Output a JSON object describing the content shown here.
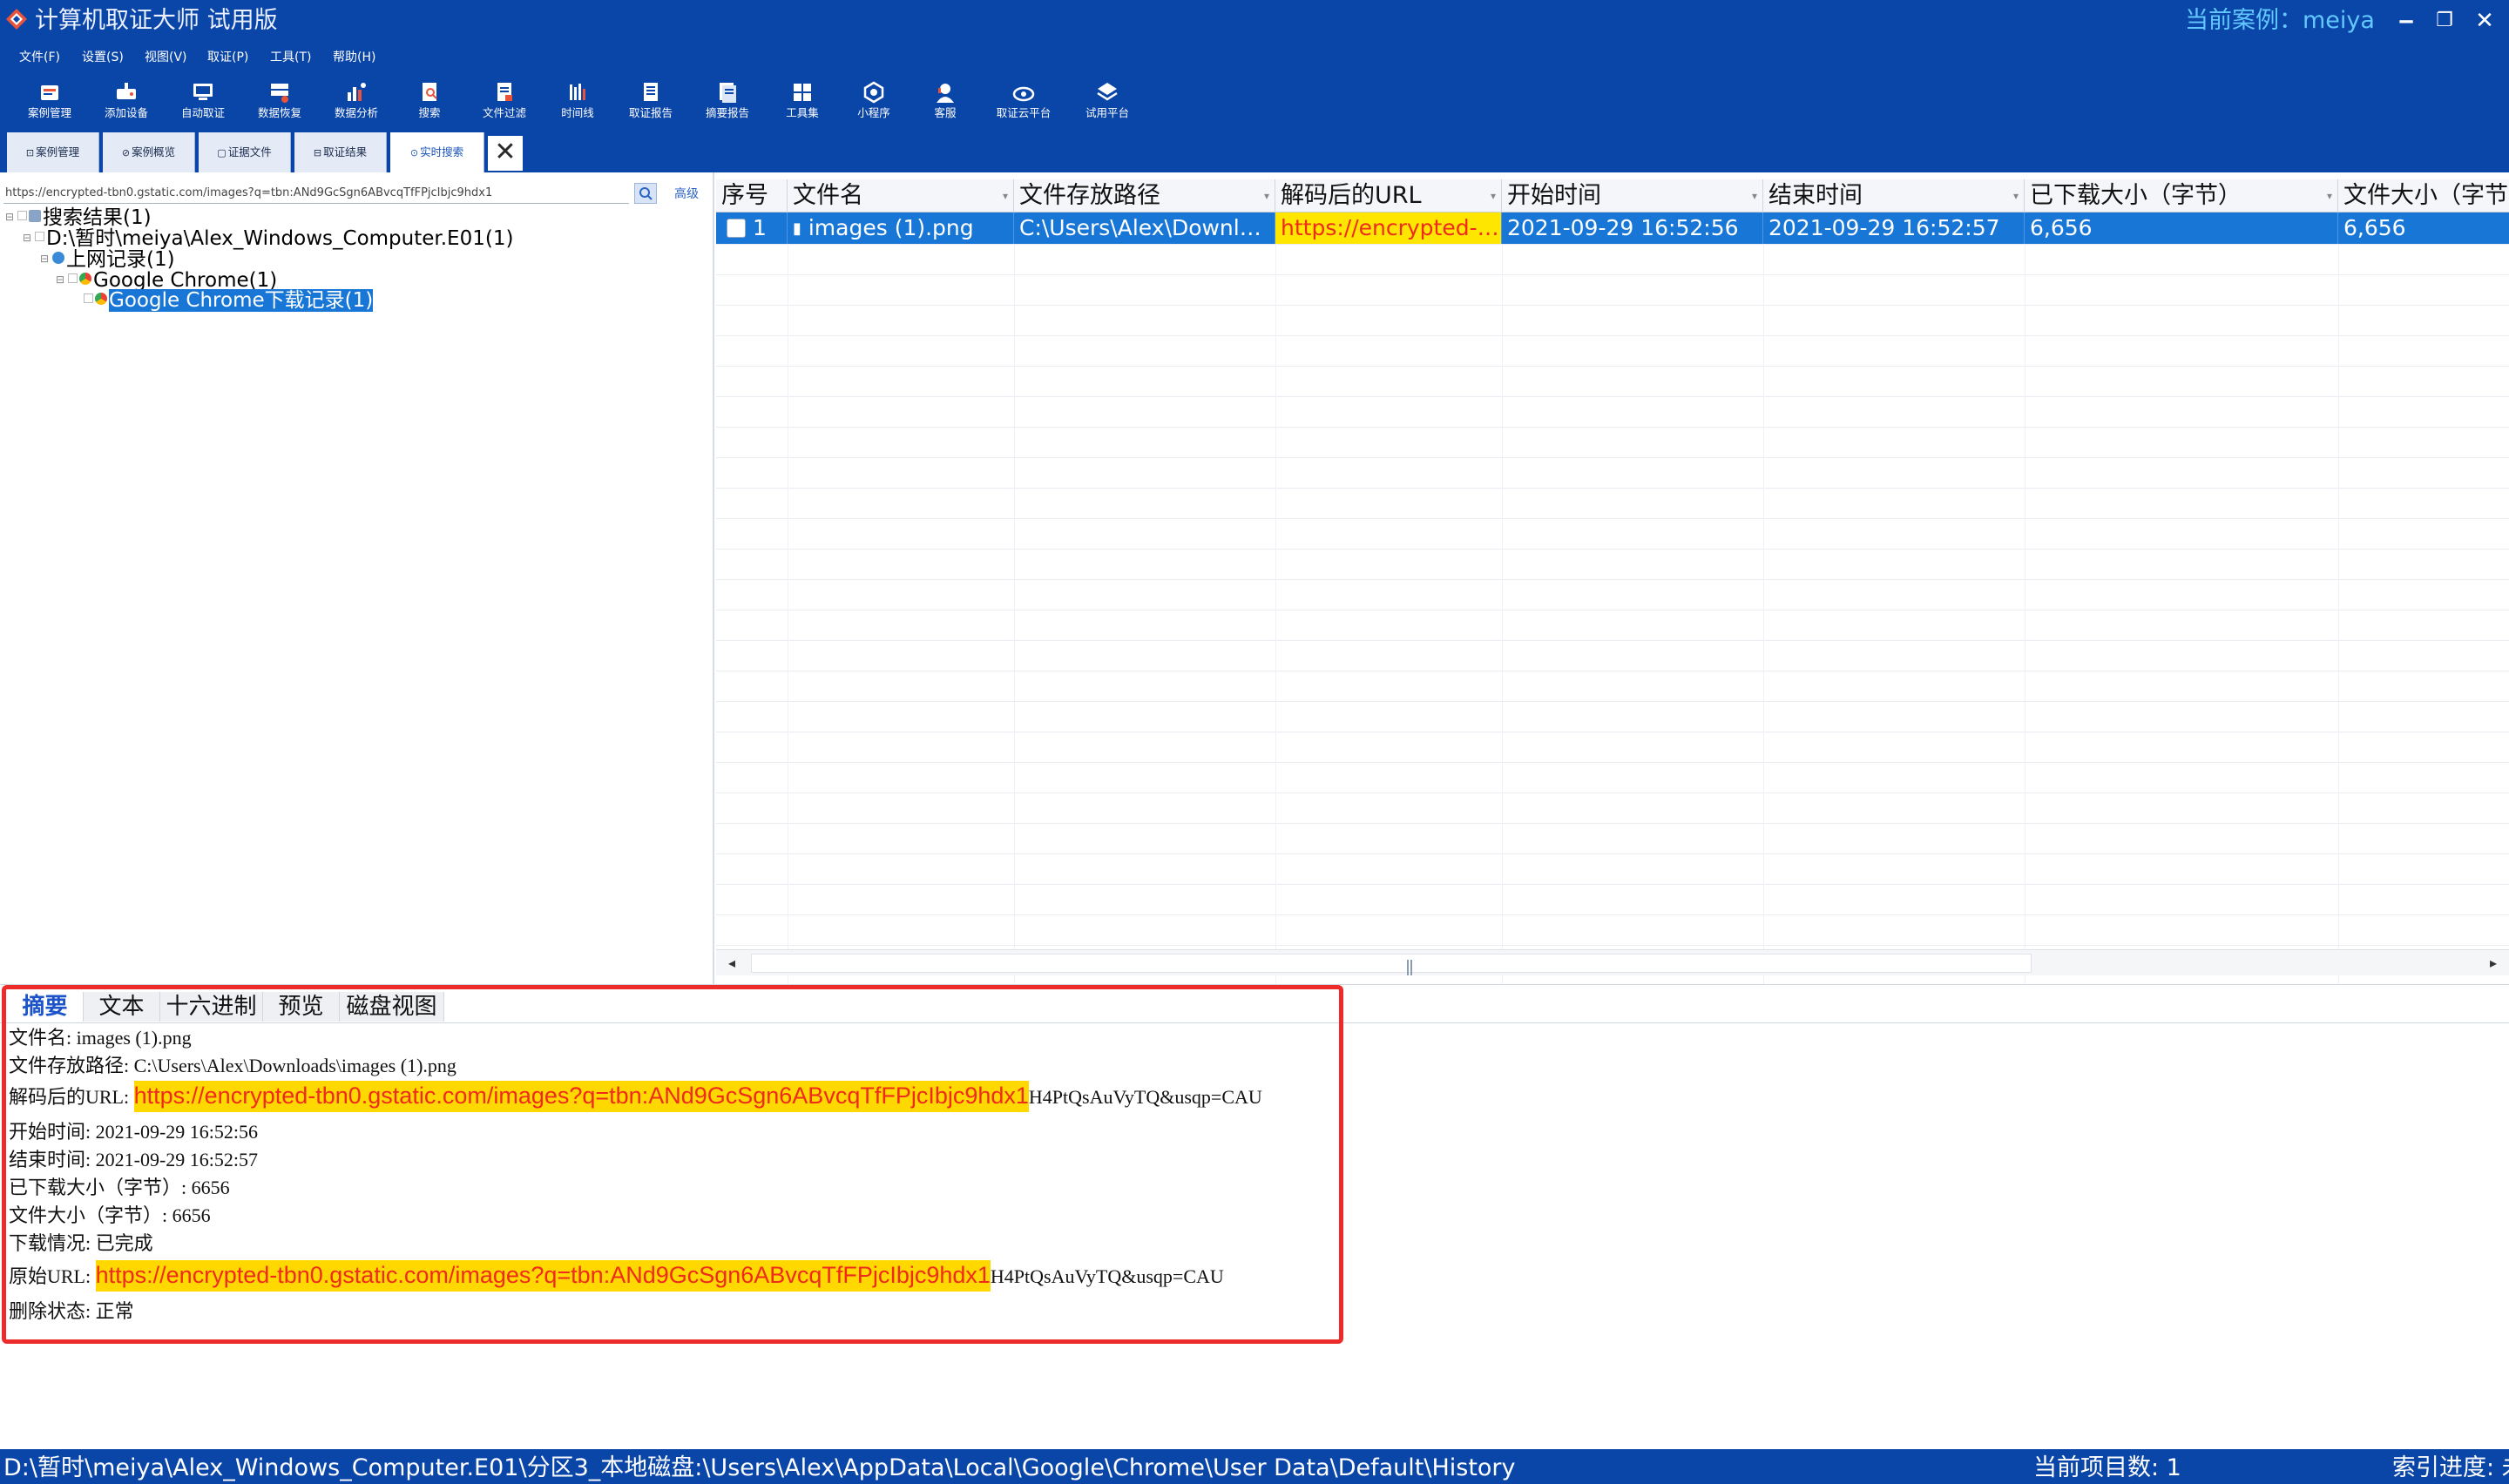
{
  "window": {
    "title": "计算机取证大师 试用版",
    "current_case": "当前案例：meiya",
    "minimize_glyph": "‒",
    "restore_glyph": "❐",
    "close_glyph": "✕"
  },
  "colors": {
    "chrome_blue": "#0a45a8",
    "selection_blue": "#1877d6",
    "highlight_yellow": "#ffd800",
    "link_red": "#ee2b1c",
    "annotation_red": "#ee2b2b"
  },
  "menu": [
    "文件(F)",
    "设置(S)",
    "视图(V)",
    "取证(P)",
    "工具(T)",
    "帮助(H)"
  ],
  "toolbar": [
    {
      "label": "案例管理",
      "icon": "case-manage-icon"
    },
    {
      "label": "添加设备",
      "icon": "add-device-icon"
    },
    {
      "label": "自动取证",
      "icon": "auto-forensics-icon"
    },
    {
      "label": "数据恢复",
      "icon": "data-recovery-icon"
    },
    {
      "label": "数据分析",
      "icon": "data-analysis-icon"
    },
    {
      "label": "搜索",
      "icon": "search-icon"
    },
    {
      "label": "文件过滤",
      "icon": "file-filter-icon"
    },
    {
      "label": "时间线",
      "icon": "timeline-icon"
    },
    {
      "label": "取证报告",
      "icon": "forensic-report-icon"
    },
    {
      "label": "摘要报告",
      "icon": "summary-report-icon"
    },
    {
      "label": "工具集",
      "icon": "toolset-icon"
    },
    {
      "label": "小程序",
      "icon": "mini-program-icon"
    },
    {
      "label": "客服",
      "icon": "customer-service-icon"
    },
    {
      "label": "取证云平台",
      "icon": "cloud-platform-icon"
    },
    {
      "label": "试用平台",
      "icon": "trial-platform-icon"
    }
  ],
  "tabs": [
    {
      "label": "案例管理",
      "glyph": "⊡"
    },
    {
      "label": "案例概览",
      "glyph": "⊘"
    },
    {
      "label": "证据文件",
      "glyph": "▢"
    },
    {
      "label": "取证结果",
      "glyph": "⊟"
    },
    {
      "label": "实时搜索",
      "glyph": "⊙",
      "active": true
    }
  ],
  "tab_close_glyph": "✕",
  "search": {
    "value": "https://encrypted-tbn0.gstatic.com/images?q=tbn:ANd9GcSgn6ABvcqTfFPjcIbjc9hdx1",
    "advanced_label": "高级"
  },
  "tree": [
    {
      "label": "搜索结果(1)",
      "level": 0,
      "icon": "search-results-icon"
    },
    {
      "label": "D:\\暂时\\meiya\\Alex_Windows_Computer.E01(1)",
      "level": 1,
      "icon": "evidence-file-icon"
    },
    {
      "label": "上网记录(1)",
      "level": 2,
      "icon": "browser-history-icon"
    },
    {
      "label": "Google Chrome(1)",
      "level": 3,
      "icon": "chrome-icon"
    },
    {
      "label": "Google Chrome下载记录(1)",
      "level": 4,
      "icon": "chrome-icon",
      "selected": true
    }
  ],
  "grid": {
    "columns": [
      "序号",
      "文件名",
      "文件存放路径",
      "解码后的URL",
      "开始时间",
      "结束时间",
      "已下载大小（字节）",
      "文件大小（字节）"
    ],
    "rows": [
      {
        "index": "1",
        "file_name": "images (1).png",
        "path": "C:\\Users\\Alex\\Downloa...",
        "decoded_url": "https://encrypted-tb...",
        "start_time": "2021-09-29 16:52:56",
        "end_time": "2021-09-29 16:52:57",
        "downloaded_size": "6,656",
        "file_size": "6,656"
      }
    ]
  },
  "detail": {
    "tabs": [
      "摘要",
      "文本",
      "十六进制",
      "预览",
      "磁盘视图"
    ],
    "lines": {
      "file_name": "文件名: images (1).png",
      "path": "文件存放路径: C:\\Users\\Alex\\Downloads\\images (1).png",
      "decoded_url_label": "解码后的URL: ",
      "decoded_url_highlight": "https://encrypted-tbn0.gstatic.com/images?q=tbn:ANd9GcSgn6ABvcqTfFPjcIbjc9hdx1",
      "decoded_url_tail": "H4PtQsAuVyTQ&usqp=CAU",
      "start_time": "开始时间: 2021-09-29 16:52:56",
      "end_time": "结束时间: 2021-09-29 16:52:57",
      "downloaded": "已下载大小（字节）: 6656",
      "size": "文件大小（字节）: 6656",
      "status": "下载情况: 已完成",
      "orig_url_label": "原始URL: ",
      "orig_url_highlight": "https://encrypted-tbn0.gstatic.com/images?q=tbn:ANd9GcSgn6ABvcqTfFPjcIbjc9hdx1",
      "orig_url_tail": "H4PtQsAuVyTQ&usqp=CAU",
      "deleted": "删除状态: 正常"
    }
  },
  "status": {
    "path": "D:\\暂时\\meiya\\Alex_Windows_Computer.E01\\分区3_本地磁盘:\\Users\\Alex\\AppData\\Local\\Google\\Chrome\\User Data\\Default\\History",
    "count": "当前项目数: 1",
    "index": "索引进度: 未"
  }
}
